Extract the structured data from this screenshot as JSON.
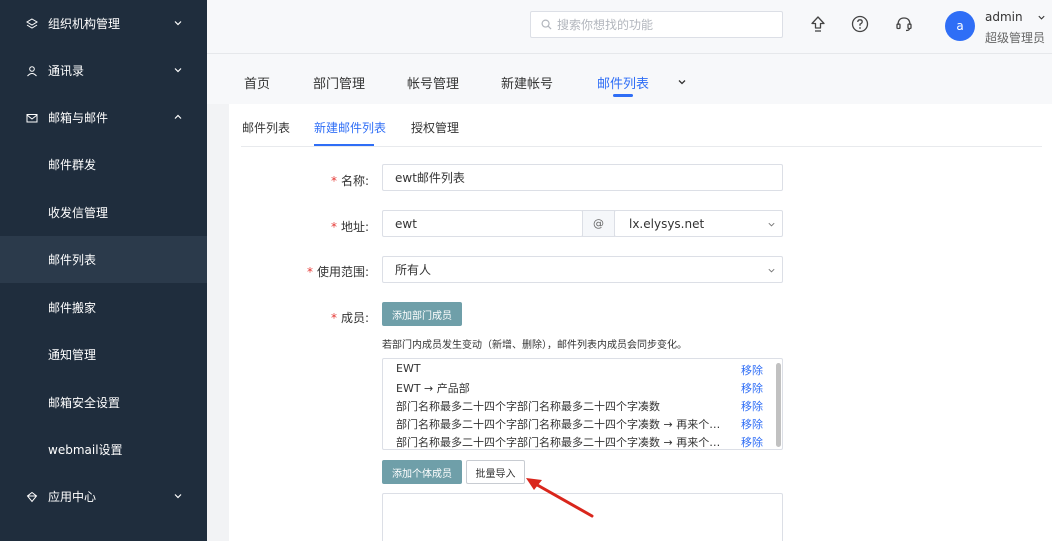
{
  "sidebar": {
    "items": [
      {
        "label": "组织机构管理",
        "type": "group",
        "icon": "layers-icon",
        "chevron": "down"
      },
      {
        "label": "通讯录",
        "type": "group",
        "icon": "contacts-icon",
        "chevron": "down"
      },
      {
        "label": "邮箱与邮件",
        "type": "group",
        "icon": "mail-icon",
        "chevron": "up"
      },
      {
        "label": "邮件群发",
        "type": "sub"
      },
      {
        "label": "收发信管理",
        "type": "sub"
      },
      {
        "label": "邮件列表",
        "type": "sub",
        "active": true
      },
      {
        "label": "邮件搬家",
        "type": "sub"
      },
      {
        "label": "通知管理",
        "type": "sub"
      },
      {
        "label": "邮箱安全设置",
        "type": "sub"
      },
      {
        "label": "webmail设置",
        "type": "sub"
      },
      {
        "label": "应用中心",
        "type": "group",
        "icon": "app-center-icon",
        "chevron": "down"
      }
    ]
  },
  "header": {
    "search_placeholder": "搜索你想找的功能",
    "avatar_letter": "a",
    "user_name": "admin",
    "user_role": "超级管理员"
  },
  "nav": {
    "tabs": [
      "首页",
      "部门管理",
      "帐号管理",
      "新建帐号",
      "邮件列表"
    ],
    "active_index": 4
  },
  "subtabs": {
    "items": [
      "邮件列表",
      "新建邮件列表",
      "授权管理"
    ],
    "active_index": 1
  },
  "form": {
    "name_label": "名称:",
    "name_value": "ewt邮件列表",
    "address_label": "地址:",
    "address_value": "ewt",
    "at_symbol": "@",
    "domain_value": "lx.elysys.net",
    "scope_label": "使用范围:",
    "scope_value": "所有人",
    "members_label": "成员:",
    "add_dept_button": "添加部门成员",
    "hint": "若部门内成员发生变动（新增、删除），邮件列表内成员会同步变化。",
    "members": [
      {
        "name": "EWT",
        "remove": "移除"
      },
      {
        "name": "EWT → 产品部",
        "remove": "移除"
      },
      {
        "name": "部门名称最多二十四个字部门名称最多二十四个字凑数",
        "remove": "移除"
      },
      {
        "name": "部门名称最多二十四个字部门名称最多二十四个字凑数 → 再来个长...",
        "remove": "移除"
      },
      {
        "name": "部门名称最多二十四个字部门名称最多二十四个字凑数 → 再来个长...",
        "remove": "移除"
      }
    ],
    "add_individual_button": "添加个体成员",
    "bulk_import_button": "批量导入"
  },
  "colors": {
    "sidebar_bg": "#1f2d3d",
    "accent": "#2f6ef6",
    "required": "#e53935",
    "button_teal": "#6f9fa9",
    "arrow": "#d9261c"
  }
}
